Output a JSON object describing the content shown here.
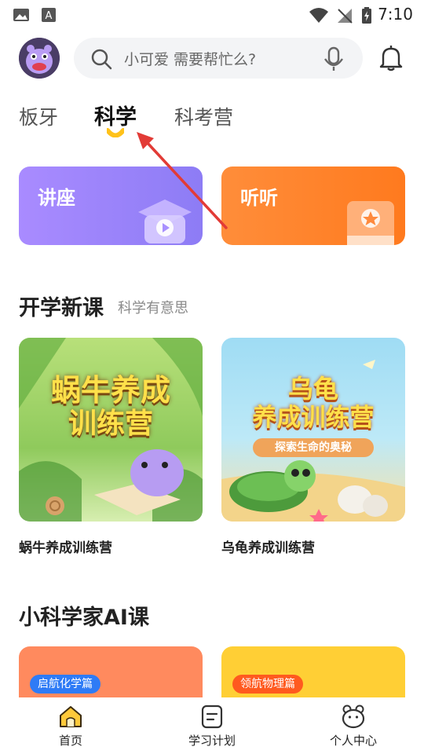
{
  "status": {
    "time": "7:10"
  },
  "search": {
    "placeholder": "小可爱 需要帮忙么?"
  },
  "tabs": [
    {
      "label": "板牙"
    },
    {
      "label": "科学"
    },
    {
      "label": "科考营"
    }
  ],
  "quick_cards": [
    {
      "label": "讲座",
      "color": "#9a86fb"
    },
    {
      "label": "听听",
      "color": "#ff8428"
    }
  ],
  "section_new": {
    "title": "开学新课",
    "subtitle": "科学有意思"
  },
  "courses": [
    {
      "art_title_1": "蜗牛养成",
      "art_title_2": "训练营",
      "name": "蜗牛养成训练营"
    },
    {
      "art_title_1": "乌龟",
      "art_title_2": "养成训练营",
      "art_banner": "探索生命的奥秘",
      "name": "乌龟养成训练营"
    }
  ],
  "section_ai": {
    "title": "小科学家AI课"
  },
  "ai_courses": [
    {
      "tag": "启航化学篇",
      "color": "#ff8a5e",
      "tag_color": "#2e7bf6"
    },
    {
      "tag": "领航物理篇",
      "color": "#ffcf35",
      "tag_color": "#ff5a1f"
    }
  ],
  "bottom_nav": [
    {
      "label": "首页",
      "icon": "home-icon"
    },
    {
      "label": "学习计划",
      "icon": "plan-icon"
    },
    {
      "label": "个人中心",
      "icon": "profile-icon"
    }
  ]
}
